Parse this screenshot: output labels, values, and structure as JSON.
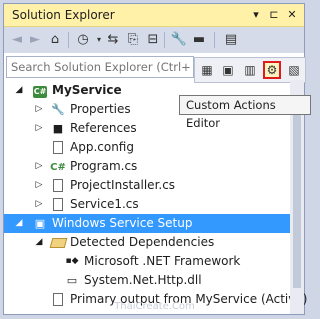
{
  "window": {
    "title": "Solution Explorer",
    "buttons": {
      "dropdown": "▾",
      "pin": "⊏",
      "close": "✕"
    }
  },
  "toolbar": {
    "icons": [
      "back-icon",
      "forward-icon",
      "home-icon",
      "history-icon",
      "sync-icon",
      "pending-changes-icon",
      "collapse-all-icon",
      "properties-icon",
      "preview-icon",
      "file-system-editor-icon"
    ]
  },
  "search": {
    "placeholder": "Search Solution Explorer (Ctrl+;)"
  },
  "setup_toolbar": {
    "icons": [
      "file-system-editor-icon",
      "registry-editor-icon",
      "file-types-editor-icon",
      "custom-actions-editor-icon",
      "launch-conditions-editor-icon"
    ],
    "active": "custom-actions-editor-icon"
  },
  "tooltip": {
    "text": "Custom Actions Editor"
  },
  "tree": {
    "items": [
      {
        "label": "MyService",
        "icon": "csharp-project-icon",
        "arrow": "◢",
        "bold": true
      },
      {
        "label": "Properties",
        "icon": "wrench-icon",
        "arrow": "▷"
      },
      {
        "label": "References",
        "icon": "references-icon",
        "arrow": "▷"
      },
      {
        "label": "App.config",
        "icon": "config-file-icon",
        "arrow": ""
      },
      {
        "label": "Program.cs",
        "icon": "csharp-file-icon",
        "arrow": "▷"
      },
      {
        "label": "ProjectInstaller.cs",
        "icon": "csharp-file-icon",
        "arrow": "▷"
      },
      {
        "label": "Service1.cs",
        "icon": "csharp-file-icon",
        "arrow": "▷"
      },
      {
        "label": "Windows Service Setup",
        "icon": "setup-project-icon",
        "arrow": "◢",
        "selected": true
      },
      {
        "label": "Detected Dependencies",
        "icon": "folder-open-icon",
        "arrow": "◢"
      },
      {
        "label": "Microsoft .NET Framework",
        "icon": "dependency-icon",
        "arrow": ""
      },
      {
        "label": "System.Net.Http.dll",
        "icon": "assembly-icon",
        "arrow": ""
      },
      {
        "label": "Primary output from MyService (Active)",
        "icon": "output-icon",
        "arrow": ""
      }
    ]
  },
  "watermark": "ThaiCreate.Com",
  "colors": {
    "title_bg": "#fff1a8",
    "selection": "#3399ff",
    "active_border": "#e01b1b",
    "toolbar_bg": "#d6dbe9"
  }
}
